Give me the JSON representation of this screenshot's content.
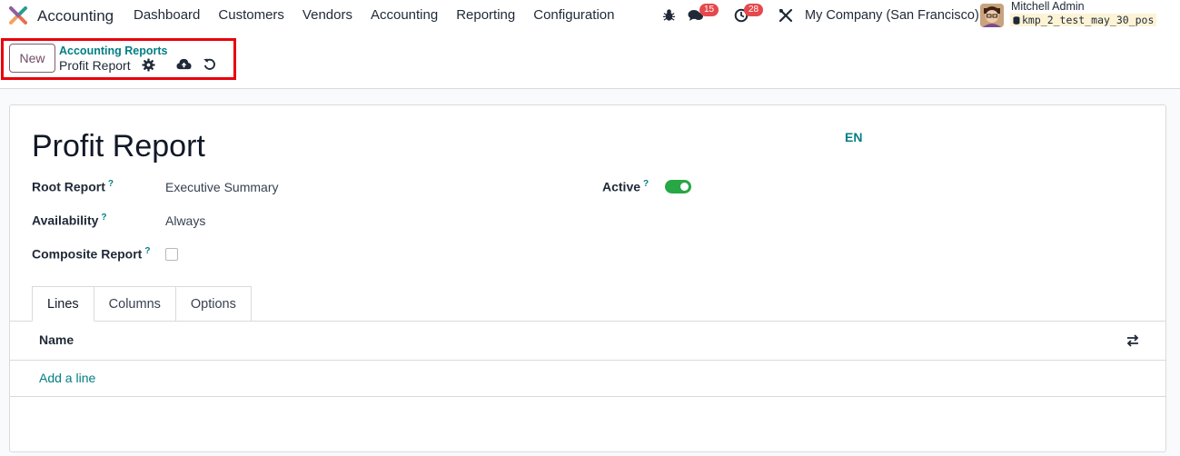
{
  "navbar": {
    "app_name": "Accounting",
    "menu": [
      "Dashboard",
      "Customers",
      "Vendors",
      "Accounting",
      "Reporting",
      "Configuration"
    ],
    "messages_count": "15",
    "activities_count": "28",
    "company": "My Company (San Francisco)",
    "user_name": "Mitchell Admin",
    "database": "kmp_2_test_may_30_pos"
  },
  "control_panel": {
    "new_label": "New",
    "breadcrumb_parent": "Accounting Reports",
    "breadcrumb_current": "Profit Report",
    "icons": [
      "gear-icon",
      "cloud-upload-icon",
      "undo-icon"
    ]
  },
  "form": {
    "title": "Profit Report",
    "language": "EN",
    "fields": {
      "root_report_label": "Root Report",
      "root_report_value": "Executive Summary",
      "availability_label": "Availability",
      "availability_value": "Always",
      "composite_label": "Composite Report",
      "composite_checked": false,
      "active_label": "Active",
      "active_on": true,
      "help_mark": "?"
    },
    "tabs": [
      "Lines",
      "Columns",
      "Options"
    ],
    "active_tab": "Lines",
    "lines": {
      "column_name": "Name",
      "add_line": "Add a line"
    }
  },
  "colors": {
    "brand": "#714b67",
    "accent": "#017e84",
    "badge": "#e5484d",
    "toggle_on": "#28a745",
    "highlight": "#e8000b"
  }
}
